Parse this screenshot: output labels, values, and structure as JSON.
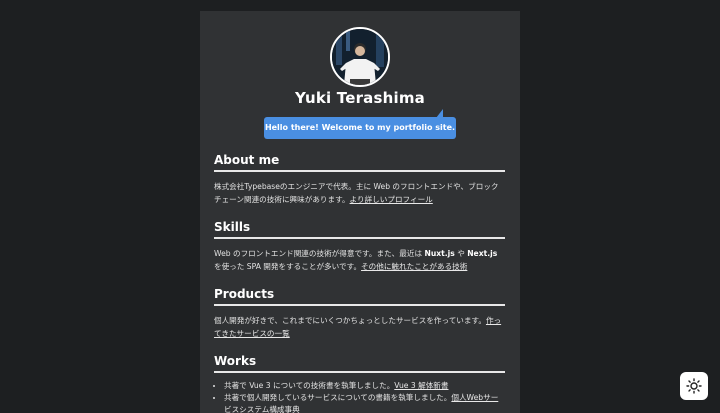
{
  "profile": {
    "name": "Yuki Terashima",
    "greeting": "Hello there! Welcome to my portfolio site."
  },
  "sections": {
    "about": {
      "title": "About me",
      "text": "株式会社Typebaseのエンジニアで代表。主に Web のフロントエンドや、ブロックチェーン関連の技術に興味があります。",
      "link": "より詳しいプロフィール"
    },
    "skills": {
      "title": "Skills",
      "text_before": "Web のフロントエンド関連の技術が得意です。また、最近は ",
      "bold1": "Nuxt.js",
      "mid": " や ",
      "bold2": "Next.js",
      "text_after": " を使った SPA 開発をすることが多いです。",
      "link": "その他に触れたことがある技術"
    },
    "products": {
      "title": "Products",
      "text": "個人開発が好きで、これまでにいくつかちょっとしたサービスを作っています。",
      "link": "作ってきたサービスの一覧"
    },
    "works": {
      "title": "Works",
      "items": [
        {
          "text": "共著で Vue 3 についての技術書を執筆しました。",
          "link": "Vue 3 解体新書"
        },
        {
          "text": "共著で個人開発しているサービスについての書籍を執筆しました。",
          "link": "個人Webサービスシステム構成事典"
        }
      ]
    }
  },
  "theme_toggle": {
    "icon": "sun-icon"
  }
}
